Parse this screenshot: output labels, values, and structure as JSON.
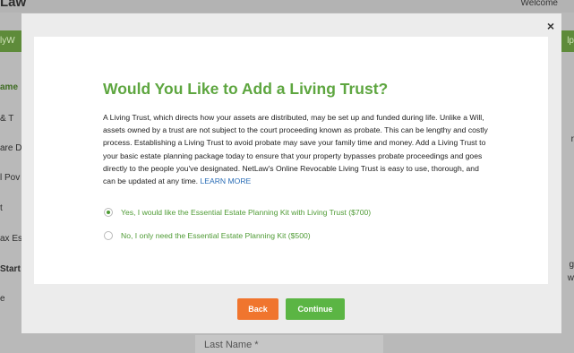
{
  "background": {
    "logo": "Law",
    "welcome": "Welcome",
    "greenbar_left": "lyW",
    "greenbar_right": "lp",
    "sidebar_items": [
      "ame",
      "& T",
      "are D",
      "l Pov",
      "t",
      "ax Es",
      "Start",
      "e"
    ],
    "right_texts": [
      "r",
      "g",
      "w"
    ],
    "last_name_field": "Last Name *"
  },
  "modal": {
    "close_symbol": "×",
    "title": "Would You Like to Add a Living Trust?",
    "body": "A Living Trust, which directs how your assets are distributed, may be set up and funded during life. Unlike a Will, assets owned by a trust are not subject to the court proceeding known as probate. This can be lengthy and costly process. Establishing a Living Trust to avoid probate may save your family time and money. Add a Living Trust to your basic estate planning package today to ensure that your property bypasses probate proceedings and goes directly to the people you've designated. NetLaw's Online Revocable Living Trust is easy to use, thorough, and can be updated at any time.",
    "learn_more": "LEARN MORE",
    "options": [
      {
        "label": "Yes, I would like the Essential Estate Planning Kit with Living Trust ($700)",
        "selected": true
      },
      {
        "label": "No, I only need the Essential Estate Planning Kit ($500)",
        "selected": false
      }
    ],
    "back_label": "Back",
    "continue_label": "Continue"
  },
  "colors": {
    "title_green": "#5ea640",
    "back_orange": "#f0752e",
    "continue_green": "#5bb544",
    "link_blue": "#2a6db6"
  }
}
